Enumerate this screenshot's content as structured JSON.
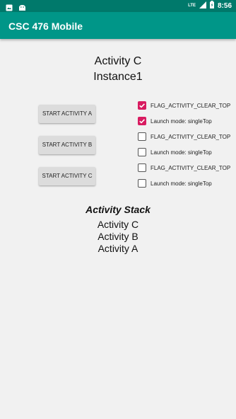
{
  "status": {
    "time": "8:56",
    "network": "LTE"
  },
  "app_bar": {
    "title": "CSC 476 Mobile"
  },
  "main": {
    "activity_name": "Activity C",
    "instance_name": "Instance1",
    "buttons": [
      {
        "label": "START ACTIVITY A"
      },
      {
        "label": "START ACTIVITY B"
      },
      {
        "label": "START ACTIVITY C"
      }
    ],
    "checkboxes": [
      {
        "label": "FLAG_ACTIVITY_CLEAR_TOP",
        "checked": true
      },
      {
        "label": "Launch mode: singleTop",
        "checked": true
      },
      {
        "label": "FLAG_ACTIVITY_CLEAR_TOP",
        "checked": false
      },
      {
        "label": "Launch mode: singleTop",
        "checked": false
      },
      {
        "label": "FLAG_ACTIVITY_CLEAR_TOP",
        "checked": false
      },
      {
        "label": "Launch mode: singleTop",
        "checked": false
      }
    ],
    "stack_title": "Activity Stack",
    "stack": [
      "Activity C",
      "Activity B",
      "Activity A"
    ]
  },
  "colors": {
    "status_bar": "#00796b",
    "app_bar": "#009688",
    "accent": "#d81b60"
  }
}
